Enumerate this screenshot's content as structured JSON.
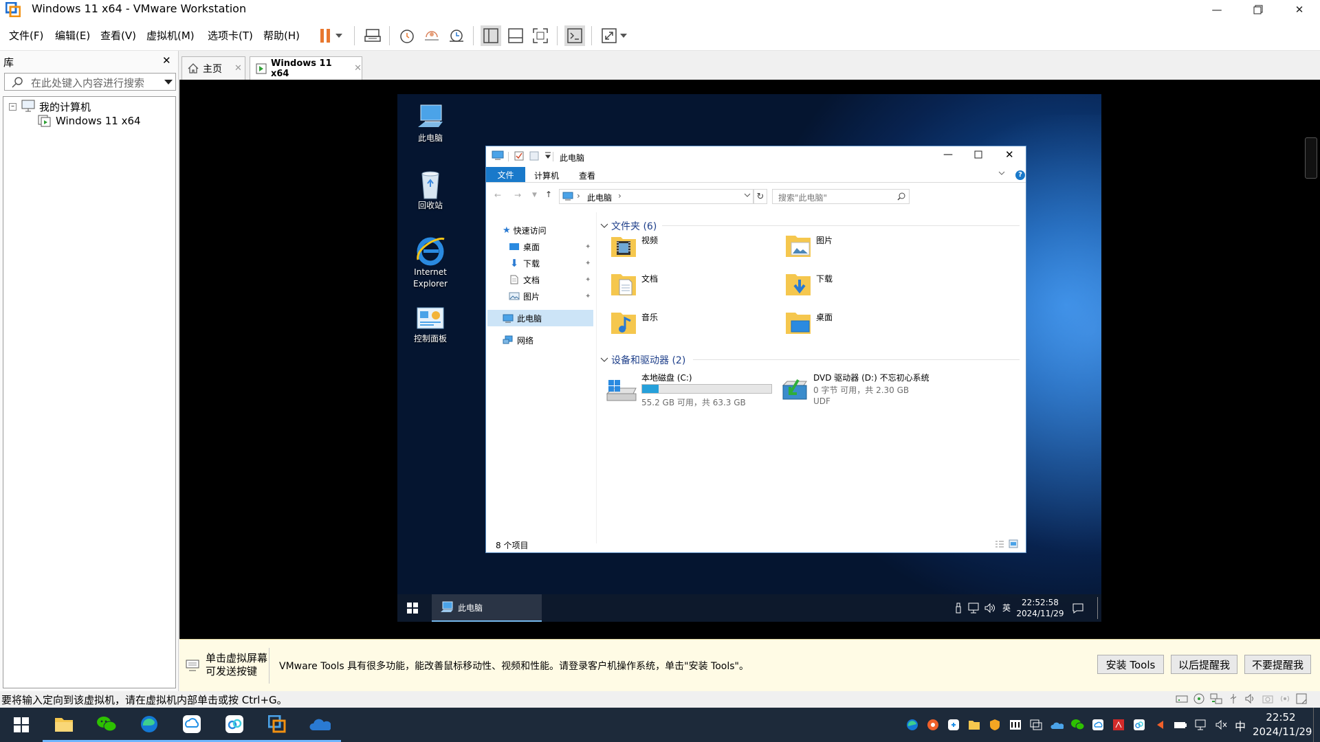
{
  "window": {
    "title": "Windows 11 x64 - VMware Workstation"
  },
  "menu": [
    "文件(F)",
    "编辑(E)",
    "查看(V)",
    "虚拟机(M)",
    "选项卡(T)",
    "帮助(H)"
  ],
  "library": {
    "title": "库",
    "search_placeholder": "在此处键入内容进行搜索",
    "root": "我的计算机",
    "vm": "Windows 11 x64"
  },
  "tabs": [
    {
      "label": "主页",
      "active": false
    },
    {
      "label": "Windows 11 x64",
      "active": true
    }
  ],
  "desktop_icons": [
    "此电脑",
    "回收站",
    "Internet Explorer",
    "控制面板"
  ],
  "explorer": {
    "title": "此电脑",
    "ribbon_tabs": [
      "文件",
      "计算机",
      "查看"
    ],
    "address": "此电脑",
    "search_placeholder": "搜索\"此电脑\"",
    "nav": {
      "quick": "快速访问",
      "items": [
        "桌面",
        "下载",
        "文档",
        "图片"
      ],
      "thispc": "此电脑",
      "network": "网络"
    },
    "folders_header": "文件夹 (6)",
    "folders": [
      "视频",
      "图片",
      "文档",
      "下载",
      "音乐",
      "桌面"
    ],
    "drives_header": "设备和驱动器 (2)",
    "drive_c": {
      "name": "本地磁盘 (C:)",
      "detail": "55.2 GB 可用，共 63.3 GB",
      "used_fraction": 0.13
    },
    "drive_d": {
      "name": "DVD 驱动器 (D:) 不忘初心系统",
      "detail": "0 字节 可用，共 2.30 GB",
      "fs": "UDF"
    },
    "status": "8 个项目"
  },
  "vm_taskbar": {
    "app": "此电脑",
    "ime": "英",
    "time": "22:52:58",
    "date": "2024/11/29"
  },
  "notify": {
    "hint_line1": "单击虚拟屏幕",
    "hint_line2": "可发送按键",
    "message": "VMware Tools 具有很多功能，能改善鼠标移动性、视频和性能。请登录客户机操作系统，单击\"安装 Tools\"。",
    "btn_install": "安装 Tools",
    "btn_later": "以后提醒我",
    "btn_never": "不要提醒我"
  },
  "statusbar": "要将输入定向到该虚拟机，请在虚拟机内部单击或按 Ctrl+G。",
  "host_taskbar": {
    "ime": "中",
    "time": "22:52",
    "date": "2024/11/29"
  },
  "colors": {
    "accent": "#0078d7",
    "ribbon_file": "#1979ca",
    "pause": "#e8772e"
  }
}
